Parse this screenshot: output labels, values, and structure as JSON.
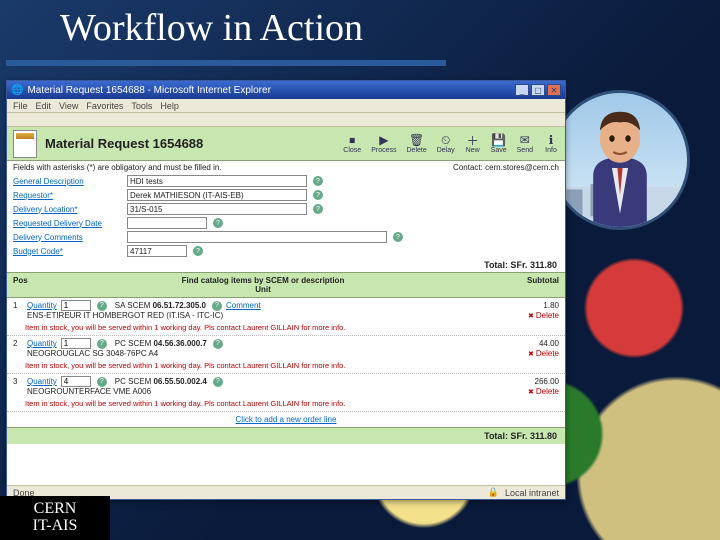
{
  "slide": {
    "title": "Workflow in Action"
  },
  "window": {
    "title": "Material Request 1654688 - Microsoft Internet Explorer",
    "menu": [
      "File",
      "Edit",
      "View",
      "Favorites",
      "Tools",
      "Help"
    ],
    "status_left": "Done",
    "status_right": "Local intranet"
  },
  "page": {
    "heading": "Material Request 1654688",
    "toolbar": [
      "Close",
      "Process",
      "Delete",
      "Delay",
      "New",
      "Save",
      "Send",
      "Info"
    ],
    "required_note": "Fields with asterisks (*) are obligatory and must be filled in.",
    "contact": "Contact: cern.stores@cern.ch",
    "total_label": "Total: SFr.",
    "total_value": "311.80"
  },
  "form": {
    "labels": {
      "general": "General Description",
      "requestor": "Requestor*",
      "location": "Delivery Location*",
      "date": "Requested Delivery Date",
      "comments": "Delivery Comments",
      "budget": "Budget Code*"
    },
    "values": {
      "general": "HDI tests",
      "requestor": "Derek MATHIESON (IT-AIS-EB)",
      "location": "31/S-015",
      "budget": "47117"
    }
  },
  "catalog": {
    "cols": {
      "pos": "Pos",
      "find": "Find catalog items by SCEM or description",
      "unit": "Unit",
      "subtotal": "Subtotal"
    },
    "qty_label": "Quantity",
    "comment_label": "Comment",
    "delete_label": "Delete",
    "add_line": "Click to add a new order line"
  },
  "lines": [
    {
      "pos": "1",
      "qty": "1",
      "scem": "06.51.72.305.0",
      "desc": "ENS-ETIREUR IT HOMBERGOT RED (IT.ISA - ITC-IC)",
      "subtotal": "1.80",
      "stock": "Item in stock, you will be served within 1 working day. Pls contact Laurent GILLAIN for more info."
    },
    {
      "pos": "2",
      "qty": "1",
      "scem": "04.56.36.000.7",
      "desc": "NEOGROUGLAC SG 3048-76PC A4",
      "subtotal": "44.00",
      "stock": "Item in stock, you will be served within 1 working day. Pls contact Laurent GILLAIN for more info."
    },
    {
      "pos": "3",
      "qty": "4",
      "scem": "06.55.50.002.4",
      "desc": "NEOGROUNTERFACE VME A006",
      "subtotal": "266.00",
      "stock": "Item in stock, you will be served within 1 working day. Pls contact Laurent GILLAIN for more info."
    }
  ],
  "footer": {
    "line1": "CERN",
    "line2": "IT-AIS"
  }
}
